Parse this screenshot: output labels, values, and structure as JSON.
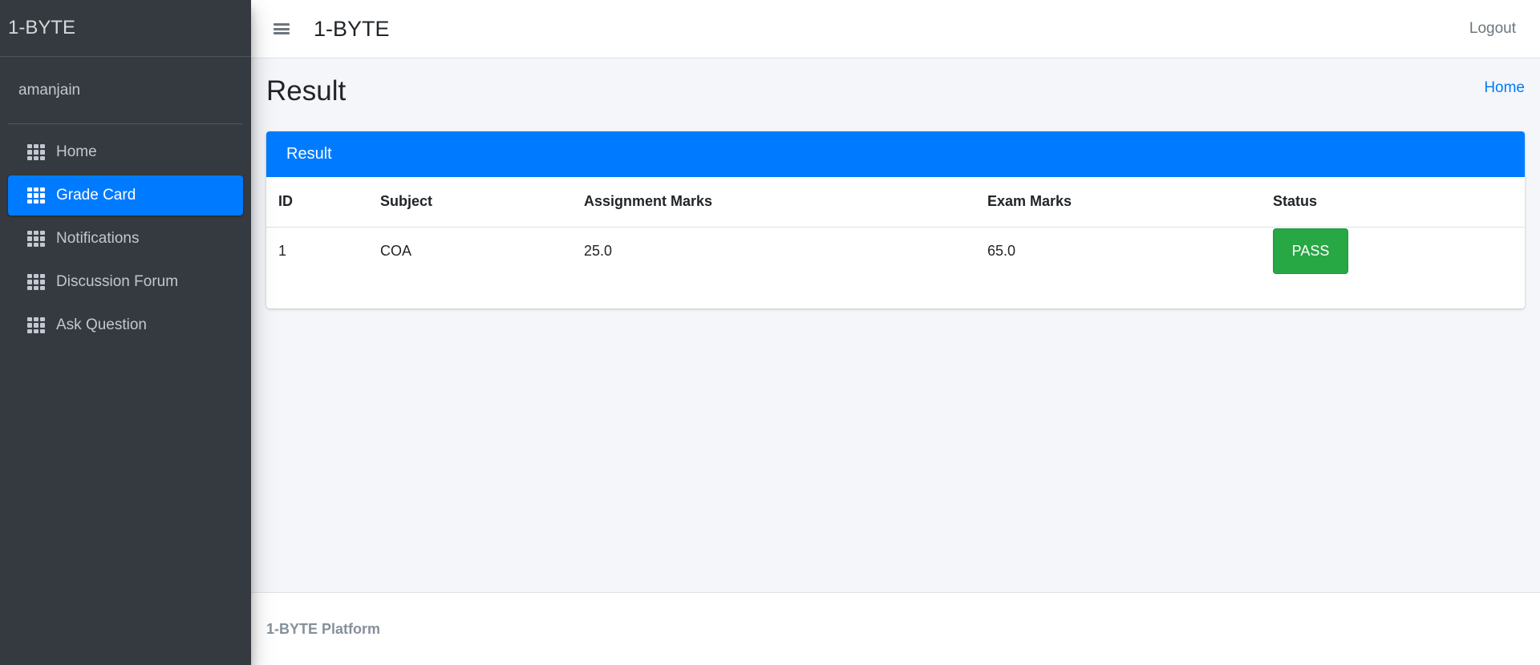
{
  "sidebar": {
    "brand": "1-BYTE",
    "user_name": "amanjain",
    "items": [
      {
        "label": "Home",
        "icon": "grid-icon"
      },
      {
        "label": "Grade Card",
        "icon": "grid-icon",
        "active": true
      },
      {
        "label": "Notifications",
        "icon": "grid-icon"
      },
      {
        "label": "Discussion Forum",
        "icon": "grid-icon"
      },
      {
        "label": "Ask Question",
        "icon": "grid-icon"
      }
    ]
  },
  "navbar": {
    "menu_icon": "hamburger-icon",
    "title": "1-BYTE",
    "logout": "Logout"
  },
  "page": {
    "title": "Result",
    "breadcrumb": "Home"
  },
  "card": {
    "header": "Result",
    "columns": [
      "ID",
      "Subject",
      "Assignment Marks",
      "Exam Marks",
      "Status"
    ],
    "rows": [
      {
        "id": "1",
        "subject": "COA",
        "assignment_marks": "25.0",
        "exam_marks": "65.0",
        "status": "PASS"
      }
    ]
  },
  "footer": {
    "text": "1-BYTE Platform"
  },
  "colors": {
    "sidebar_bg": "#343a40",
    "accent": "#007bff",
    "pass": "#28a745"
  }
}
